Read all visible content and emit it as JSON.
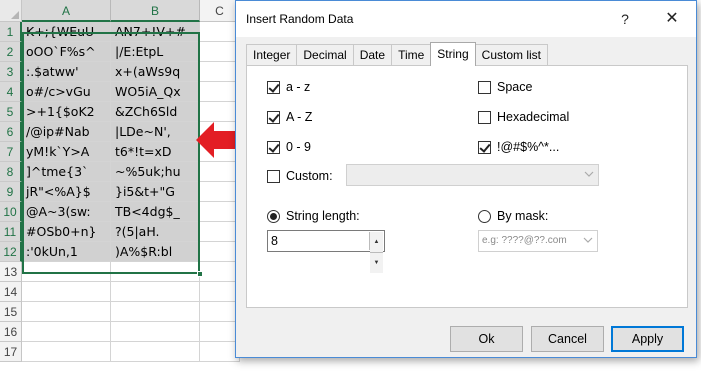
{
  "sheet": {
    "columns": [
      "A",
      "B",
      "C"
    ],
    "rows": [
      {
        "num": "1",
        "a": "K+;{WEuU",
        "b": "AN7+!V+#"
      },
      {
        "num": "2",
        "a": "oOO`F%s^",
        "b": "|/E:EtpL"
      },
      {
        "num": "3",
        "a": ":.$atww'",
        "b": "x+(aWs9q"
      },
      {
        "num": "4",
        "a": "o#/c>vGu",
        "b": "WO5iA_Qx"
      },
      {
        "num": "5",
        "a": ">+1{$oK2",
        "b": "&ZCh6Sld"
      },
      {
        "num": "6",
        "a": "/@ip#Nab",
        "b": "|LDe~N',"
      },
      {
        "num": "7",
        "a": "yM!k`Y>A",
        "b": "t6*!t=xD"
      },
      {
        "num": "8",
        "a": "]^tme{3`",
        "b": "~%5uk;hu"
      },
      {
        "num": "9",
        "a": "jR\"<%A}$",
        "b": "}i5&t+\"G"
      },
      {
        "num": "10",
        "a": "@A~3(sw:",
        "b": "TB<4dg$_"
      },
      {
        "num": "11",
        "a": "#OSb0+n}",
        "b": "?(5|aH."
      },
      {
        "num": "12",
        "a": ":'0kUn,1",
        "b": ")A%$R:bl"
      },
      {
        "num": "13",
        "a": "",
        "b": ""
      },
      {
        "num": "14",
        "a": "",
        "b": ""
      },
      {
        "num": "15",
        "a": "",
        "b": ""
      },
      {
        "num": "16",
        "a": "",
        "b": ""
      },
      {
        "num": "17",
        "a": "",
        "b": ""
      }
    ],
    "selected_rows": 12
  },
  "arrow_color": "#e31e24",
  "dialog": {
    "title": "Insert Random Data",
    "help_glyph": "?",
    "close_glyph": "✕",
    "tabs": [
      "Integer",
      "Decimal",
      "Date",
      "Time",
      "String",
      "Custom list"
    ],
    "active_tab": "String",
    "options": {
      "lower": {
        "label": "a - z",
        "checked": true
      },
      "upper": {
        "label": "A - Z",
        "checked": true
      },
      "digits": {
        "label": "0 - 9",
        "checked": true
      },
      "space": {
        "label": "Space",
        "checked": false
      },
      "hex": {
        "label": "Hexadecimal",
        "checked": false
      },
      "symbols": {
        "label": "!@#$%^*...",
        "checked": true
      },
      "custom": {
        "label": "Custom:",
        "checked": false,
        "value": ""
      }
    },
    "string_length": {
      "label": "String length:",
      "selected": true,
      "value": "8"
    },
    "by_mask": {
      "label": "By mask:",
      "selected": false,
      "placeholder": "e.g: ????@??.com"
    },
    "buttons": {
      "ok": "Ok",
      "cancel": "Cancel",
      "apply": "Apply"
    }
  }
}
